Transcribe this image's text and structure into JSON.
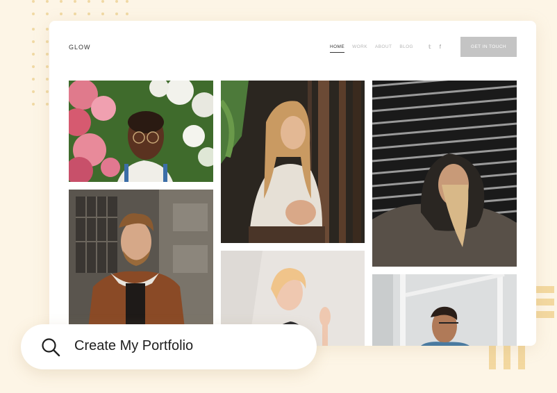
{
  "site": {
    "logo": "GLOW",
    "nav": [
      "HOME",
      "WORK",
      "ABOUT",
      "BLOG"
    ],
    "active_nav": "HOME",
    "social_icons": [
      "twitter-icon",
      "facebook-icon"
    ],
    "social_glyphs": [
      "𝕥",
      "f"
    ],
    "cta_label": "GET IN TOUCH"
  },
  "gallery": {
    "photos": [
      "woman-with-flowers-photo",
      "woman-in-forest-photo",
      "person-in-hoodie-photo",
      "man-in-jacket-photo",
      "blonde-woman-photo",
      "man-with-glasses-photo"
    ]
  },
  "search": {
    "text": "Create My Portfolio",
    "icon": "search-icon"
  },
  "colors": {
    "background": "#fdf5e6",
    "accent": "#f3d8a0",
    "cta": "#c4c4c4"
  }
}
